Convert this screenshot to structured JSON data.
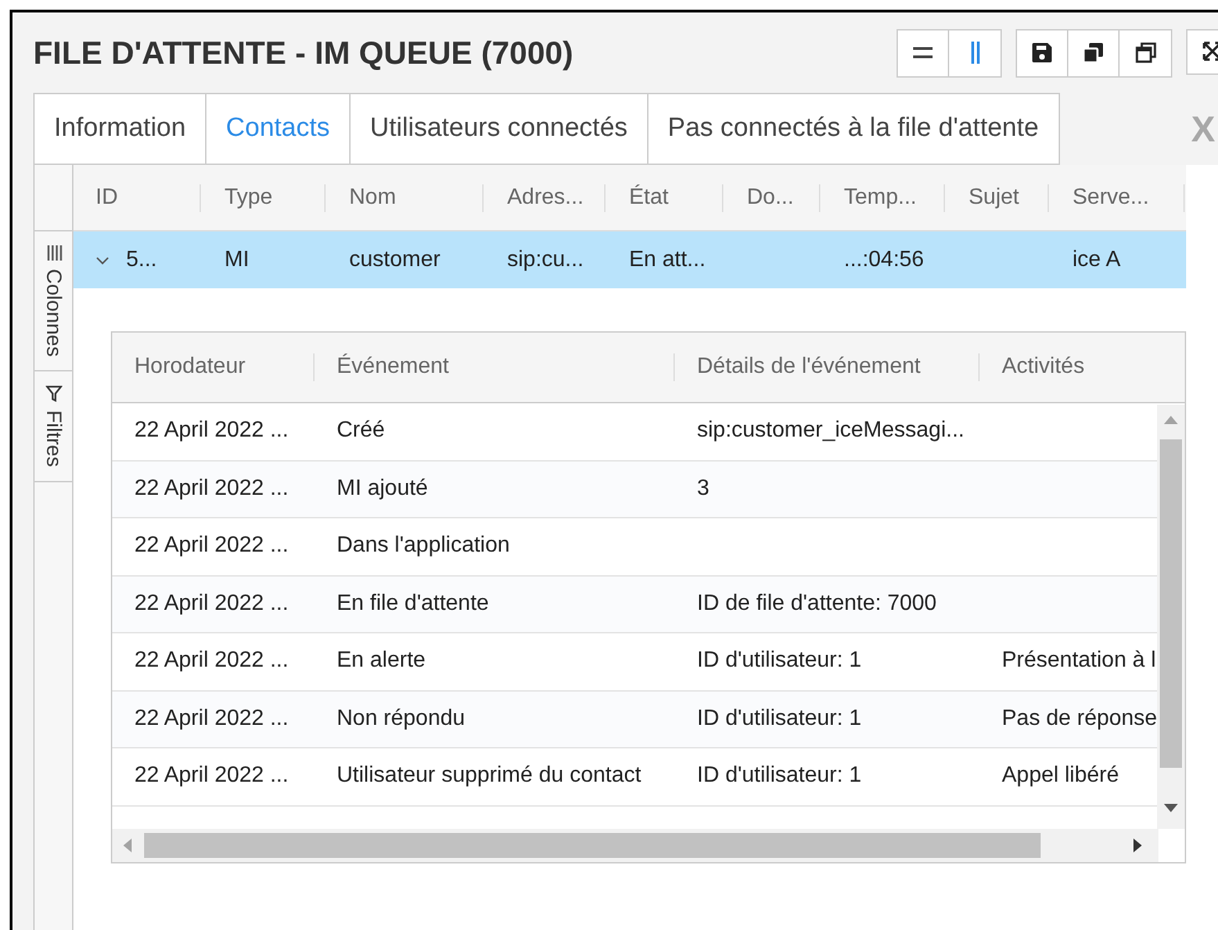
{
  "window": {
    "title": "FILE D'ATTENTE - IM QUEUE (7000)"
  },
  "tabs": [
    {
      "label": "Information",
      "selected": false
    },
    {
      "label": "Contacts",
      "selected": true
    },
    {
      "label": "Utilisateurs connectés",
      "selected": false
    },
    {
      "label": "Pas connectés à la file d'attente",
      "selected": false
    }
  ],
  "close_label": "X",
  "side_panel": [
    {
      "label": "Colonnes",
      "kind": "columns"
    },
    {
      "label": "Filtres",
      "kind": "filters"
    }
  ],
  "table": {
    "columns": [
      "ID",
      "Type",
      "Nom",
      "Adres...",
      "État",
      "Do...",
      "Temp...",
      "Sujet",
      "Serve..."
    ],
    "rows": [
      {
        "selected": true,
        "expanded": true,
        "cells": [
          "5...",
          "MI",
          "customer",
          "sip:cu...",
          "En att...",
          "",
          "...:04:56",
          "",
          "ice A"
        ]
      }
    ]
  },
  "detail_table": {
    "columns": [
      "Horodateur",
      "Événement",
      "Détails de l'événement",
      "Activités"
    ],
    "rows": [
      [
        "22 April 2022 ...",
        "Créé",
        "sip:customer_iceMessagi...",
        ""
      ],
      [
        "22 April 2022 ...",
        "MI ajouté",
        "3",
        ""
      ],
      [
        "22 April 2022 ...",
        "Dans l'application",
        "",
        ""
      ],
      [
        "22 April 2022 ...",
        "En file d'attente",
        "ID de file d'attente: 7000",
        ""
      ],
      [
        "22 April 2022 ...",
        "En alerte",
        "ID d'utilisateur: 1",
        "Présentation à l"
      ],
      [
        "22 April 2022 ...",
        "Non répondu",
        "ID d'utilisateur: 1",
        "Pas de réponse"
      ],
      [
        "22 April 2022 ...",
        "Utilisateur supprimé du contact",
        "ID d'utilisateur: 1",
        "Appel libéré"
      ]
    ]
  }
}
